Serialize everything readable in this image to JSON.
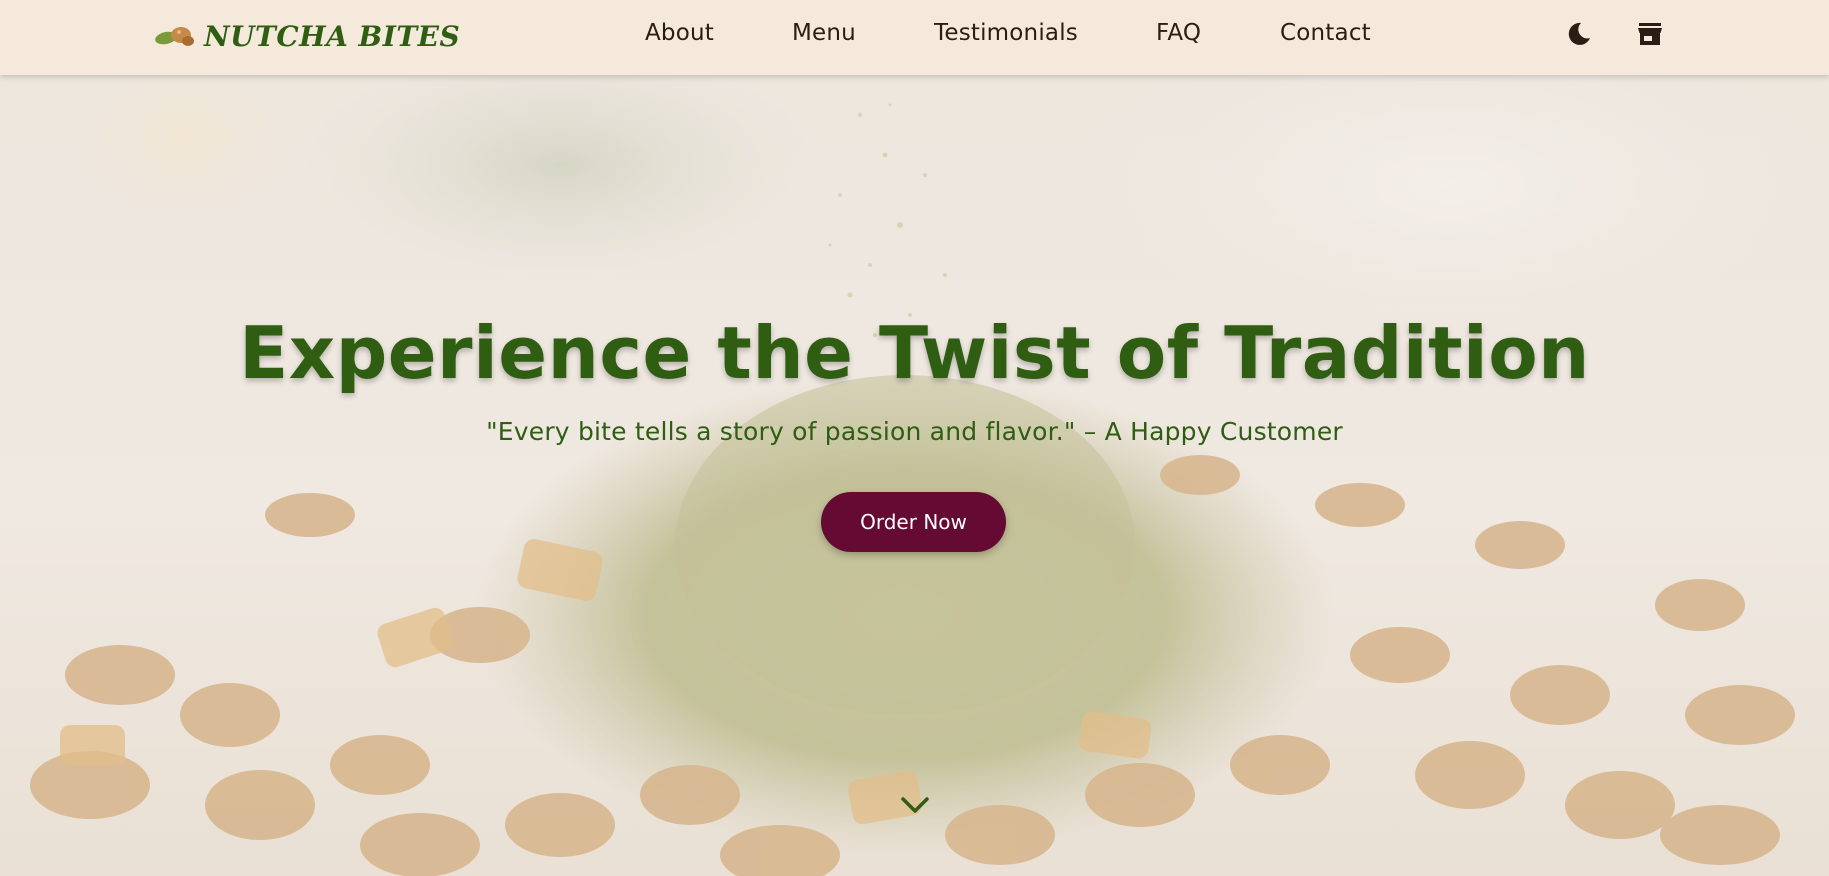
{
  "brand": {
    "name": "NUTCHA BITES"
  },
  "nav": {
    "about": "About",
    "menu": "Menu",
    "testimonials": "Testimonials",
    "faq": "FAQ",
    "contact": "Contact"
  },
  "icons": {
    "logo": "peanut-logo-icon",
    "theme": "moon-icon",
    "shop": "storefront-icon",
    "scroll": "chevron-down-icon"
  },
  "hero": {
    "title": "Experience the Twist of Tradition",
    "quote": "\"Every bite tells a story of passion and flavor.\" – A Happy Customer",
    "cta": "Order Now"
  },
  "colors": {
    "brand_green": "#2f5d12",
    "cta_maroon": "#650a32",
    "nav_bg": "#f5e9dc",
    "nav_text": "#2a1e14"
  }
}
